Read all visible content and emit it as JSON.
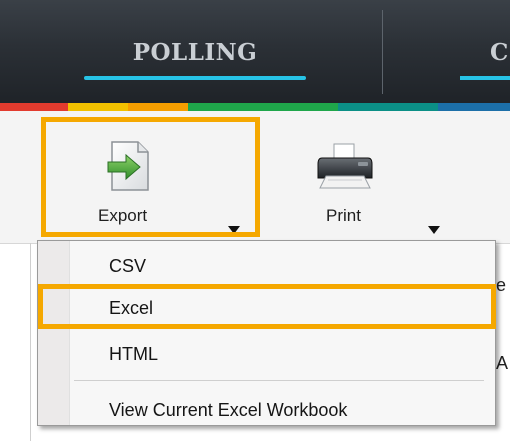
{
  "top_nav": {
    "tabs": [
      {
        "label": "POLLING",
        "active": true
      },
      {
        "label": "C",
        "active": false
      }
    ],
    "accent_color": "#27c3e6",
    "stripe_colors": [
      "#e23b2e",
      "#f2c100",
      "#f59e00",
      "#1fa64a",
      "#0b8f86",
      "#1c6fa8"
    ]
  },
  "toolbar": {
    "export": {
      "label": "Export",
      "icon": "export-document-icon"
    },
    "print": {
      "label": "Print",
      "icon": "printer-icon"
    },
    "highlight_color": "#f5a800"
  },
  "background_text": {
    "line1": "e",
    "line2": "A"
  },
  "export_menu": {
    "items": [
      {
        "label": "CSV"
      },
      {
        "label": "Excel",
        "highlighted": true
      },
      {
        "label": "HTML"
      },
      {
        "label": "View Current Excel Workbook"
      }
    ]
  }
}
